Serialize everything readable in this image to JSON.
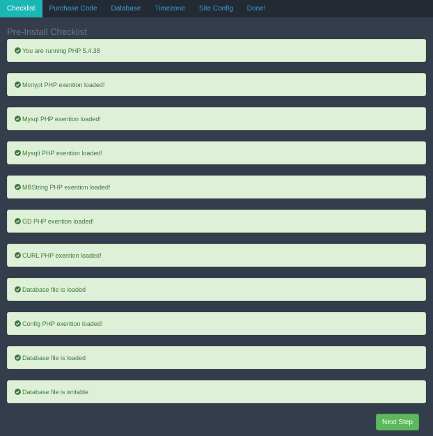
{
  "nav": {
    "tabs": [
      {
        "label": "Checklist",
        "active": true
      },
      {
        "label": "Purchase Code",
        "active": false
      },
      {
        "label": "Database",
        "active": false
      },
      {
        "label": "Timezone",
        "active": false
      },
      {
        "label": "Site Config",
        "active": false
      },
      {
        "label": "Done!",
        "active": false
      }
    ]
  },
  "page": {
    "title": "Pre-Install Checklist"
  },
  "checks": [
    {
      "icon": "check-circle-icon",
      "text": "You are running PHP 5.4.38"
    },
    {
      "icon": "check-circle-icon",
      "text": "Mcriypt PHP exention loaded!"
    },
    {
      "icon": "check-circle-icon",
      "text": "Mysql PHP exention loaded!"
    },
    {
      "icon": "check-circle-icon",
      "text": "Mysqli PHP exention loaded!"
    },
    {
      "icon": "check-circle-icon",
      "text": "MBString PHP exention loaded!"
    },
    {
      "icon": "check-circle-icon",
      "text": "GD PHP exention loaded!"
    },
    {
      "icon": "check-circle-icon",
      "text": "CURL PHP exention loaded!"
    },
    {
      "icon": "check-circle-icon",
      "text": "Database file is loaded"
    },
    {
      "icon": "check-circle-icon",
      "text": "Config PHP exention loaded!"
    },
    {
      "icon": "check-circle-icon",
      "text": "Database file is loaded"
    },
    {
      "icon": "check-circle-icon",
      "text": "Database file is writable"
    }
  ],
  "actions": {
    "next_label": "Next Step"
  },
  "colors": {
    "background": "#343d4b",
    "nav_background": "#232a34",
    "nav_active": "#1ab7b5",
    "nav_link": "#3a9fd8",
    "success_bg": "#dff0d8",
    "success_text": "#3f7a3f",
    "button": "#5cb85c"
  }
}
